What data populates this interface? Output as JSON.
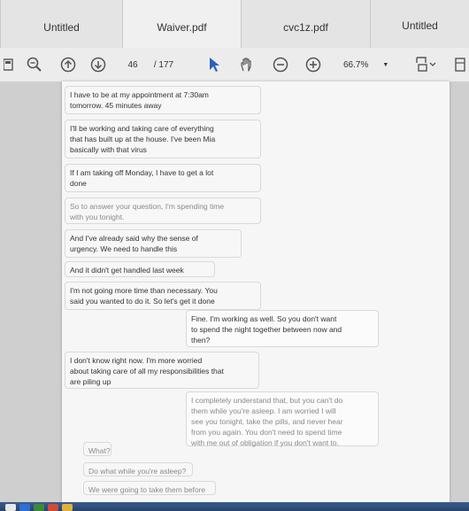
{
  "tabs": [
    {
      "label": "Untitled"
    },
    {
      "label": "Waiver.pdf"
    },
    {
      "label": "cvc1z.pdf"
    },
    {
      "label": "Untitled"
    }
  ],
  "toolbar": {
    "page_current": "46",
    "page_total": "/ 177",
    "zoom": "66.7%"
  },
  "messages": [
    {
      "text": "I have to be at my appointment at 7:30am\ntomorrow. 45 minutes away"
    },
    {
      "text": "I'll be working and taking care of everything\nthat has built up at the house. I've been Mia\nbasically with that virus"
    },
    {
      "text": "If I am taking off Monday, I have to get a lot\ndone"
    },
    {
      "text": "So to answer your question, I'm spending time\nwith you tonight."
    },
    {
      "text": "And I've already said why the sense of\nurgency. We need to handle this"
    },
    {
      "text": "And it didn't get handled last week"
    },
    {
      "text": "I'm not going more time than necessary. You\nsaid you wanted to do it. So let's get it done"
    },
    {
      "text": "Fine. I'm working as well. So you don't want\nto spend the night together between now and\nthen?"
    },
    {
      "text": "I don't know right now. I'm more worried\nabout taking care of all my responsibilities that\nare piling up"
    },
    {
      "text": "I completely understand that, but you can't do\nthem while you're asleep. I am worried I will\nsee you tonight, take the pills, and never hear\nfrom you again. You don't need to spend time\nwith me out of obligation if you don't want to."
    },
    {
      "text": "What?"
    },
    {
      "text": "Do what while you're asleep?"
    },
    {
      "text": "We were going to take them before"
    }
  ]
}
